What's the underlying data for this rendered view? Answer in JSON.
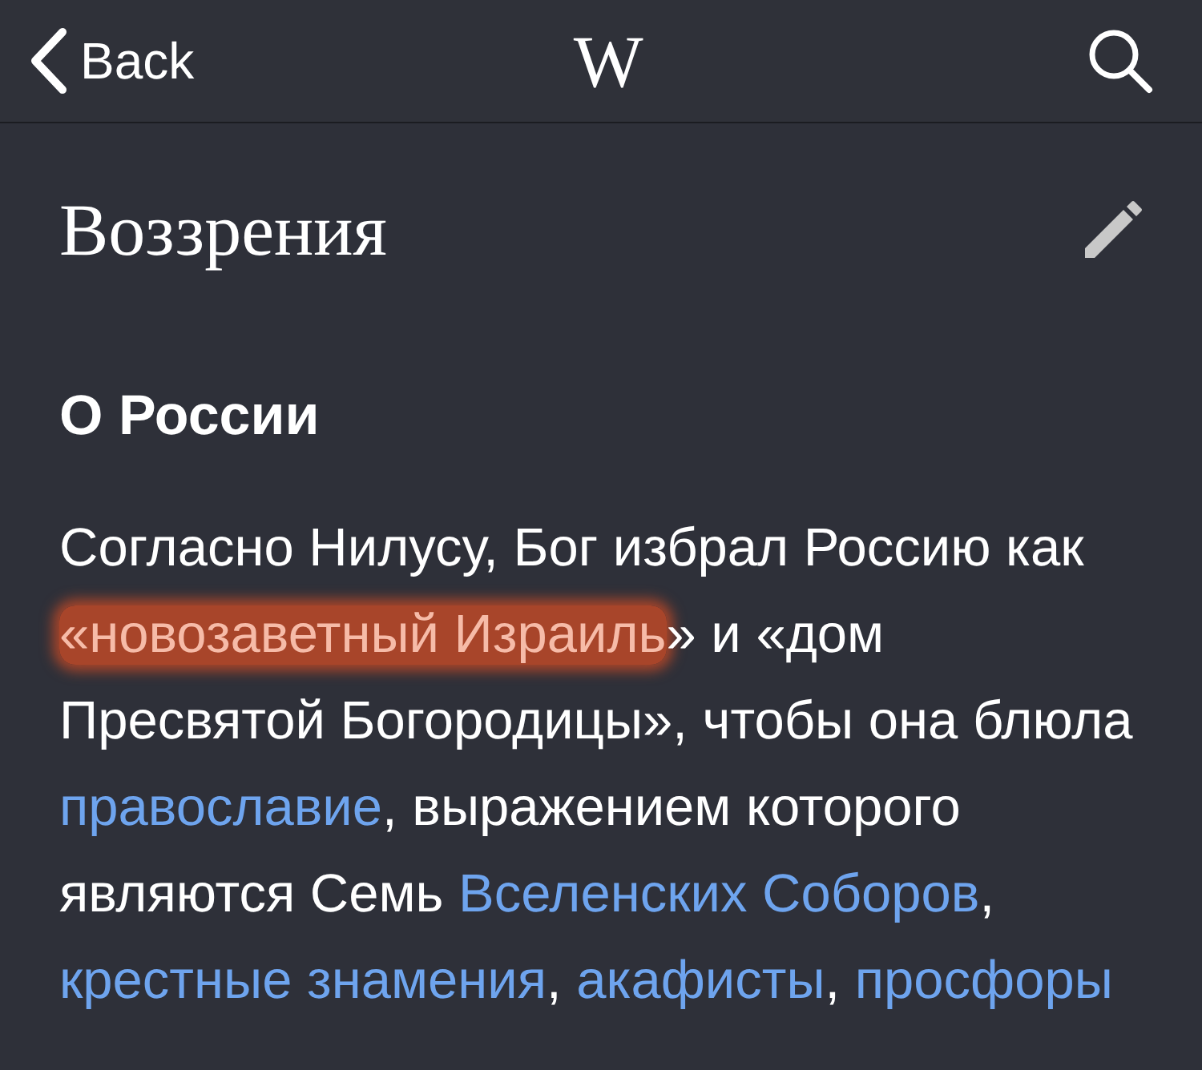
{
  "nav_bar": {
    "back_label": "Back",
    "logo": "W"
  },
  "section": {
    "title": "Воззрения",
    "heading": "О России",
    "paragraph": [
      {
        "kind": "text",
        "text": "Согласно Нилусу, Бог избрал Россию как "
      },
      {
        "kind": "highlighted_link",
        "text": "«новозаветный Израиль"
      },
      {
        "kind": "text",
        "text": "» и «дом Пресвятой Богородицы», чтобы она блюла "
      },
      {
        "kind": "link",
        "text": "православие"
      },
      {
        "kind": "text",
        "text": ", выражением которого являются Семь "
      },
      {
        "kind": "link",
        "text": "Вселенских Соборов"
      },
      {
        "kind": "text",
        "text": ", "
      },
      {
        "kind": "link",
        "text": "крестные знамения"
      },
      {
        "kind": "text",
        "text": ", "
      },
      {
        "kind": "link",
        "text": "акафисты"
      },
      {
        "kind": "text",
        "text": ", "
      },
      {
        "kind": "link",
        "text": "просфоры"
      }
    ]
  }
}
